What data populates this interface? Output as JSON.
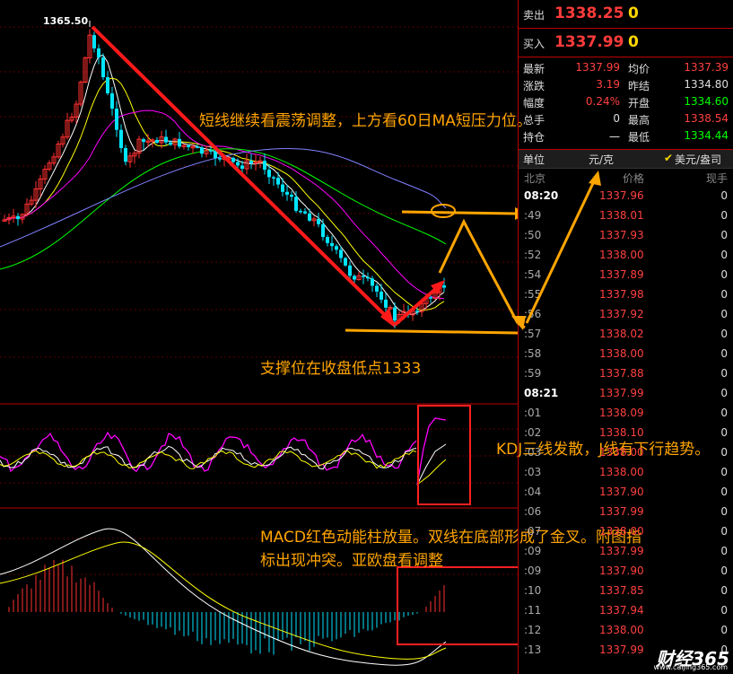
{
  "quotes": {
    "sell": {
      "label": "卖出",
      "price": "1338.25",
      "vol": "0"
    },
    "buy": {
      "label": "买入",
      "price": "1337.99",
      "vol": "0"
    }
  },
  "stats": [
    {
      "k": "最新",
      "v": "1337.99",
      "c": "#ff4040"
    },
    {
      "k": "均价",
      "v": "1337.39",
      "c": "#ff4040"
    },
    {
      "k": "涨跌",
      "v": "3.19",
      "c": "#ff4040"
    },
    {
      "k": "昨结",
      "v": "1334.80",
      "c": "#ddd"
    },
    {
      "k": "幅度",
      "v": "0.24%",
      "c": "#ff4040"
    },
    {
      "k": "开盘",
      "v": "1334.60",
      "c": "#00ff00"
    },
    {
      "k": "总手",
      "v": "0",
      "c": "#ddd"
    },
    {
      "k": "最高",
      "v": "1338.54",
      "c": "#ff4040"
    },
    {
      "k": "持仓",
      "v": "一",
      "c": "#ddd"
    },
    {
      "k": "最低",
      "v": "1334.44",
      "c": "#00ff00"
    }
  ],
  "unit": {
    "label": "单位",
    "rmb": "元/克",
    "usd": "美元/盎司"
  },
  "header": {
    "city": "北京",
    "price": "价格",
    "vol": "现手"
  },
  "ticks": [
    {
      "t": "08:20",
      "p": "1337.96",
      "v": "0",
      "bold": true
    },
    {
      "t": ":49",
      "p": "1338.01",
      "v": "0"
    },
    {
      "t": ":50",
      "p": "1337.93",
      "v": "0"
    },
    {
      "t": ":52",
      "p": "1338.00",
      "v": "0"
    },
    {
      "t": ":54",
      "p": "1337.89",
      "v": "0"
    },
    {
      "t": ":55",
      "p": "1337.98",
      "v": "0"
    },
    {
      "t": ":56",
      "p": "1337.92",
      "v": "0"
    },
    {
      "t": ":57",
      "p": "1338.02",
      "v": "0"
    },
    {
      "t": ":58",
      "p": "1338.00",
      "v": "0"
    },
    {
      "t": ":59",
      "p": "1337.88",
      "v": "0"
    },
    {
      "t": "08:21",
      "p": "1337.99",
      "v": "0",
      "bold": true
    },
    {
      "t": ":01",
      "p": "1338.09",
      "v": "0"
    },
    {
      "t": ":02",
      "p": "1338.10",
      "v": "0"
    },
    {
      "t": ":03",
      "p": "1338.00",
      "v": "0"
    },
    {
      "t": ":03",
      "p": "1338.00",
      "v": "0"
    },
    {
      "t": ":04",
      "p": "1337.90",
      "v": "0"
    },
    {
      "t": ":06",
      "p": "1337.99",
      "v": "0"
    },
    {
      "t": ":07",
      "p": "1338.00",
      "v": "0"
    },
    {
      "t": ":09",
      "p": "1337.99",
      "v": "0"
    },
    {
      "t": ":09",
      "p": "1337.90",
      "v": "0"
    },
    {
      "t": ":10",
      "p": "1337.85",
      "v": "0"
    },
    {
      "t": ":11",
      "p": "1337.94",
      "v": "0"
    },
    {
      "t": ":12",
      "p": "1338.00",
      "v": "0"
    },
    {
      "t": ":13",
      "p": "1337.99",
      "v": "0"
    }
  ],
  "chart": {
    "high_label": "1365.50",
    "colors": {
      "up": "#ff3030",
      "down": "#00e5ff",
      "ma5": "#ffffff",
      "ma10": "#ffff00",
      "ma20": "#ff00ff",
      "ma40": "#00ff00",
      "ma60": "#8080ff"
    }
  },
  "annotations": {
    "top": "短线继续看震荡调整，上方看60日MA短压力位。",
    "support": "支撑位在收盘低点1333",
    "kdj": "KDJ三线发散，J线有下行趋势。",
    "macd": "MACD红色动能柱放量。双线在底部形成了金叉。附图指标出现冲突。亚欧盘看调整"
  },
  "logo": {
    "main": "财经365",
    "sub": "www.caijing365.com"
  }
}
